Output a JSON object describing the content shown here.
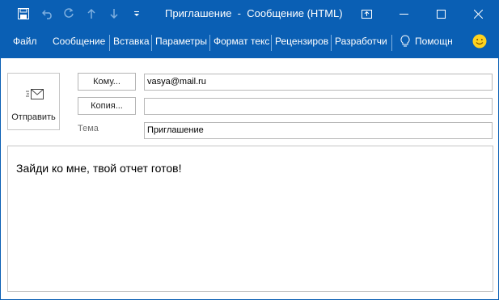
{
  "window": {
    "title": "Приглашение  -  Сообщение (HTML)"
  },
  "quick_access": [
    "save-icon",
    "undo-icon",
    "redo-icon",
    "up-arrow-icon",
    "down-arrow-icon",
    "customize-qat-icon"
  ],
  "ribbon": {
    "tabs": [
      "Файл",
      "Сообщение",
      "Вставка",
      "Параметры",
      "Формат текс",
      "Рецензиров",
      "Разработчи",
      "Помощн"
    ]
  },
  "compose": {
    "send_label": "Отправить",
    "to_button": "Кому...",
    "cc_button": "Копия...",
    "subject_label": "Тема",
    "to_value": "vasya@mail.ru",
    "cc_value": "",
    "subject_value": "Приглашение",
    "body_text": "Зайди ко мне, твой отчет готов!"
  },
  "colors": {
    "titlebar": "#0a5fb4",
    "border": "#c6c6c6"
  }
}
